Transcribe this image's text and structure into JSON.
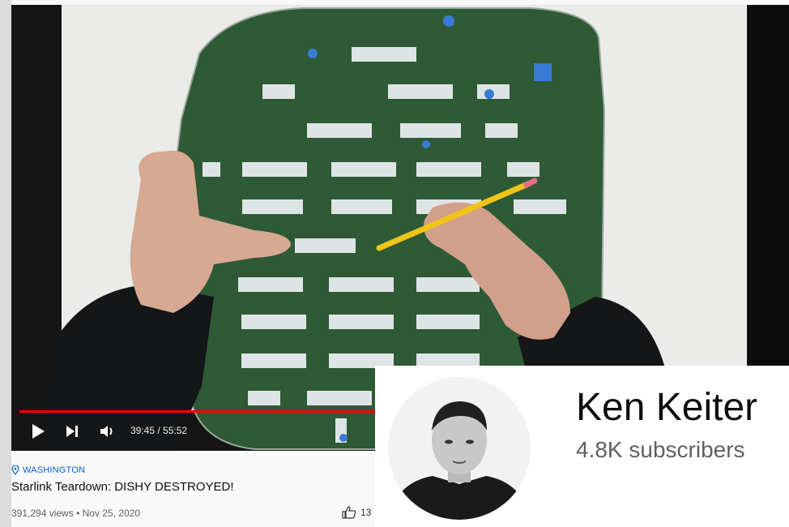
{
  "player": {
    "time_current": "39:45",
    "time_total": "55:52",
    "progress_fraction": 0.711
  },
  "video": {
    "location": "WASHINGTON",
    "title": "Starlink Teardown: DISHY DESTROYED!",
    "views": "391,294 views",
    "separator": "•",
    "date": "Nov 25, 2020",
    "likes": "13"
  },
  "channel": {
    "name": "Ken Keiter",
    "subscribers": "4.8K subscribers"
  },
  "icons": {
    "play": "play-icon",
    "next": "next-icon",
    "volume": "volume-icon",
    "location": "location-pin-icon",
    "like": "thumbs-up-icon"
  },
  "colors": {
    "progress": "#ff0000",
    "location": "#065fd4",
    "board": "#2e5a36"
  }
}
